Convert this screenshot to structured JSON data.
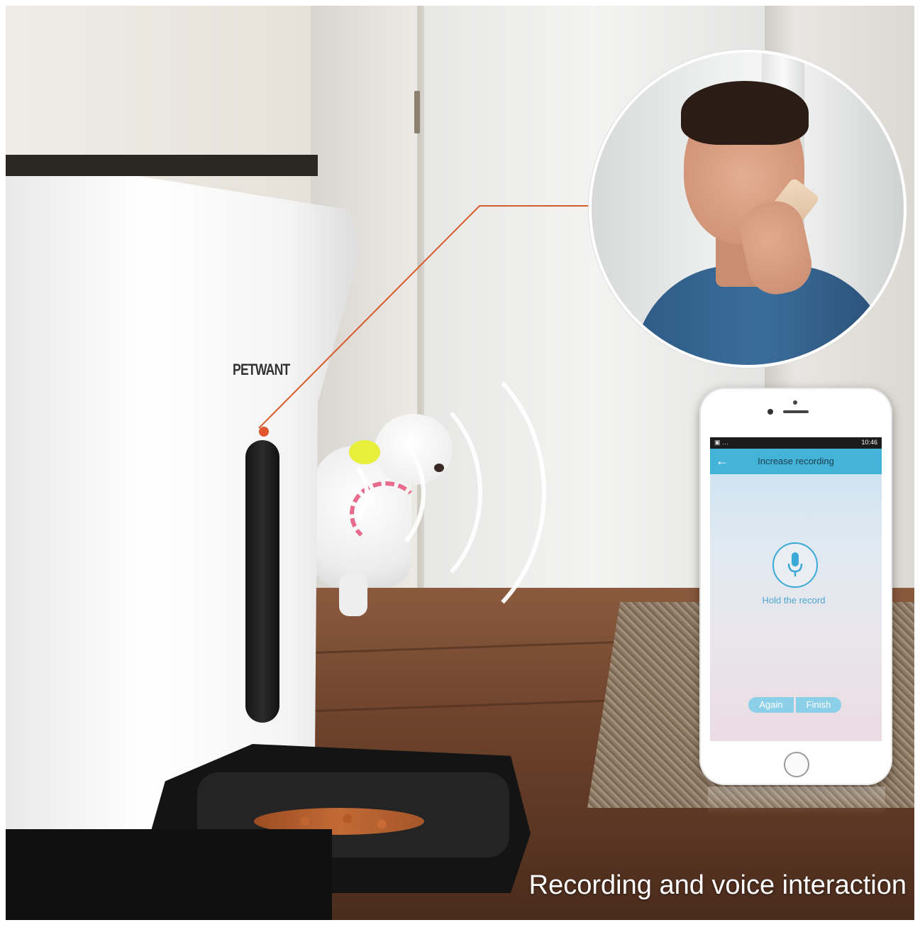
{
  "feeder": {
    "brand": "PETWANT"
  },
  "app": {
    "status_time": "10:46",
    "status_left": "▣ …",
    "title": "Increase recording",
    "back_symbol": "←",
    "hold_label": "Hold the record",
    "again_label": "Again",
    "finish_label": "Finish",
    "accent_color": "#43b4d8"
  },
  "caption": "Recording and voice interaction"
}
